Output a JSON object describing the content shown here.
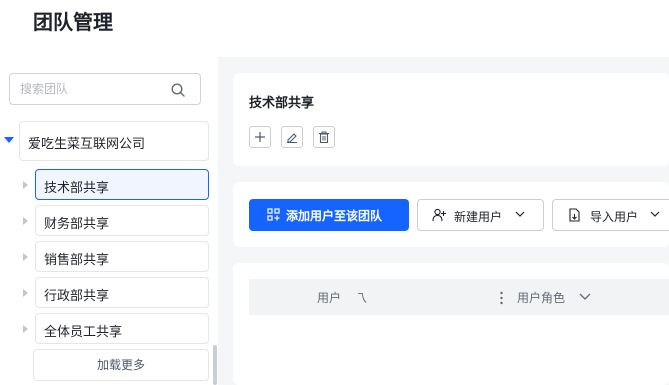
{
  "page": {
    "title": "团队管理"
  },
  "search": {
    "placeholder": "搜索团队"
  },
  "tree": {
    "root_label": "爱吃生菜互联网公司",
    "items": [
      {
        "label": "技术部共享",
        "selected": true
      },
      {
        "label": "财务部共享",
        "selected": false
      },
      {
        "label": "销售部共享",
        "selected": false
      },
      {
        "label": "行政部共享",
        "selected": false
      },
      {
        "label": "全体员工共享",
        "selected": false
      }
    ],
    "load_more_label": "加载更多"
  },
  "group": {
    "title": "技术部共享"
  },
  "toolbar": {
    "add_user_label": "添加用户至该团队",
    "new_user_label": "新建用户",
    "import_user_label": "导入用户"
  },
  "table": {
    "columns": [
      "用户",
      "乁",
      "用户角色"
    ]
  },
  "colors": {
    "accent": "#1664ff",
    "panel_bg": "#f5f6f7"
  }
}
